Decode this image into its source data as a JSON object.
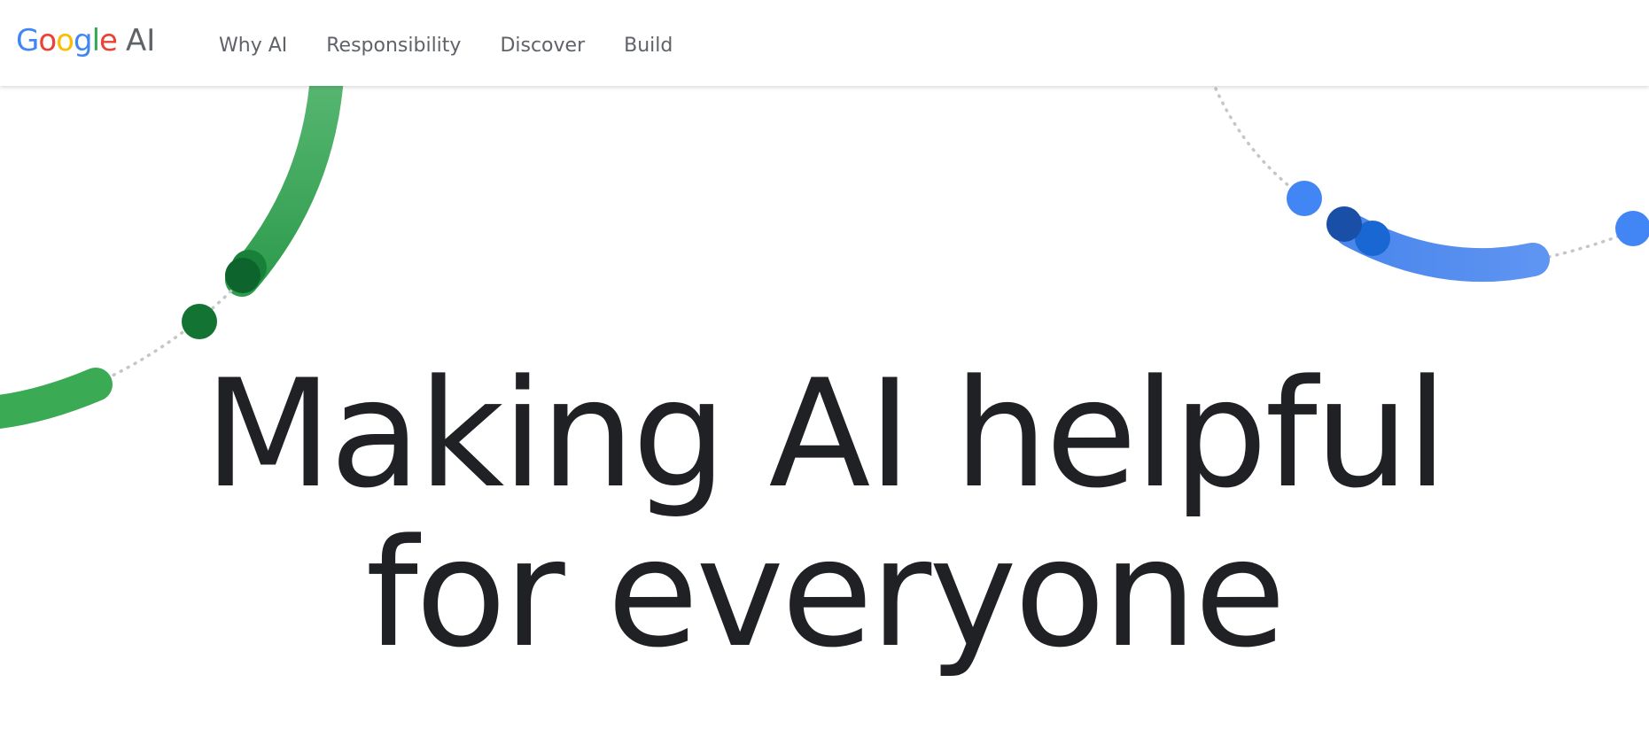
{
  "brand": {
    "letters": [
      "G",
      "o",
      "o",
      "g",
      "l",
      "e"
    ],
    "letter_colors": [
      "#4285f4",
      "#ea4335",
      "#fbbc04",
      "#4285f4",
      "#34a853",
      "#ea4335"
    ],
    "suffix": "AI",
    "suffix_color": "#5f6368"
  },
  "nav": {
    "items": [
      {
        "label": "Why AI"
      },
      {
        "label": "Responsibility"
      },
      {
        "label": "Discover"
      },
      {
        "label": "Build"
      }
    ]
  },
  "hero": {
    "line1": "Making AI helpful",
    "line2": "for everyone"
  },
  "colors": {
    "text": "#202124",
    "nav_text": "#5f6368",
    "green": "#34a853",
    "dark_green": "#137333",
    "darker_green": "#0d652d",
    "blue": "#4285f4",
    "dark_blue": "#1a4fa8",
    "mid_blue": "#1967d2",
    "dots": "#c4c7c5"
  }
}
